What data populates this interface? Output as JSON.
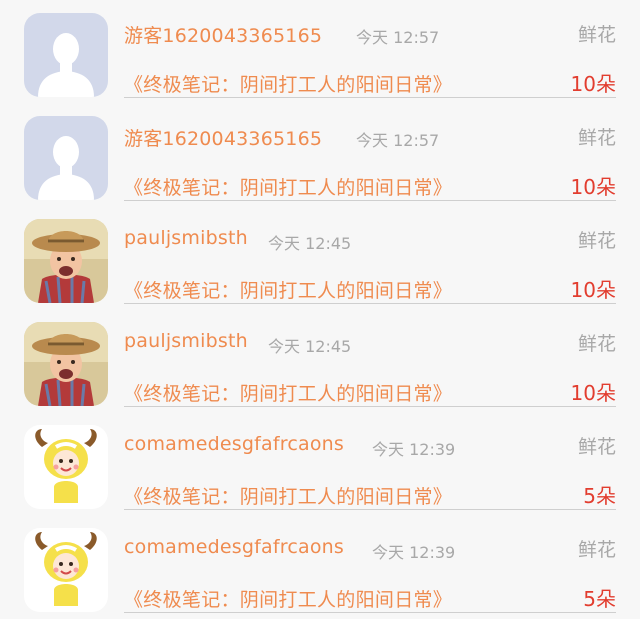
{
  "colors": {
    "background": "#f7f7f7",
    "username": "#ef8b4f",
    "book_title": "#ef8b4f",
    "meta_text": "#a8a8a8",
    "gift_count": "#e23d2f",
    "divider": "#cfcfcf"
  },
  "records": [
    {
      "avatar": "default-avatar-icon",
      "username": "游客1620043365165",
      "time": "今天 12:57",
      "gift_type": "鲜花",
      "book_title": "《终极笔记：阴间打工人的阳间日常》",
      "gift_count": "10朵"
    },
    {
      "avatar": "default-avatar-icon",
      "username": "游客1620043365165",
      "time": "今天 12:57",
      "gift_type": "鲜花",
      "book_title": "《终极笔记：阴间打工人的阳间日常》",
      "gift_count": "10朵"
    },
    {
      "avatar": "child-cowboy-hat-avatar",
      "username": "pauljsmibsth",
      "time": "今天 12:45",
      "gift_type": "鲜花",
      "book_title": "《终极笔记：阴间打工人的阳间日常》",
      "gift_count": "10朵"
    },
    {
      "avatar": "child-cowboy-hat-avatar",
      "username": "pauljsmibsth",
      "time": "今天 12:45",
      "gift_type": "鲜花",
      "book_title": "《终极笔记：阴间打工人的阳间日常》",
      "gift_count": "10朵"
    },
    {
      "avatar": "cartoon-goat-avatar",
      "username": "comamedesgfafrcaons",
      "time": "今天 12:39",
      "gift_type": "鲜花",
      "book_title": "《终极笔记：阴间打工人的阳间日常》",
      "gift_count": "5朵"
    },
    {
      "avatar": "cartoon-goat-avatar",
      "username": "comamedesgfafrcaons",
      "time": "今天 12:39",
      "gift_type": "鲜花",
      "book_title": "《终极笔记：阴间打工人的阳间日常》",
      "gift_count": "5朵"
    }
  ]
}
